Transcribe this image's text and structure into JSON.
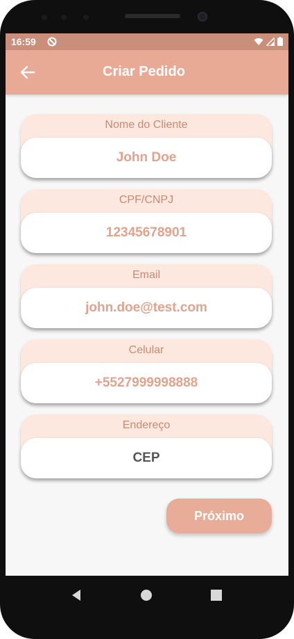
{
  "status_bar": {
    "time": "16:59"
  },
  "app_bar": {
    "title": "Criar Pedido",
    "back_icon": "arrow-left-icon",
    "color": "#e8aa95"
  },
  "form": {
    "fields": [
      {
        "label": "Nome do Cliente",
        "value": "John Doe"
      },
      {
        "label": "CPF/CNPJ",
        "value": "12345678901"
      },
      {
        "label": "Email",
        "value": "john.doe@test.com"
      },
      {
        "label": "Celular",
        "value": "+5527999998888"
      },
      {
        "label": "Endereço",
        "placeholder": "CEP"
      }
    ]
  },
  "actions": {
    "next_label": "Próximo"
  },
  "colors": {
    "accent": "#e8aa95",
    "card_background": "#fde8df",
    "label_text": "#c98a70",
    "value_text": "#e2a28c"
  }
}
